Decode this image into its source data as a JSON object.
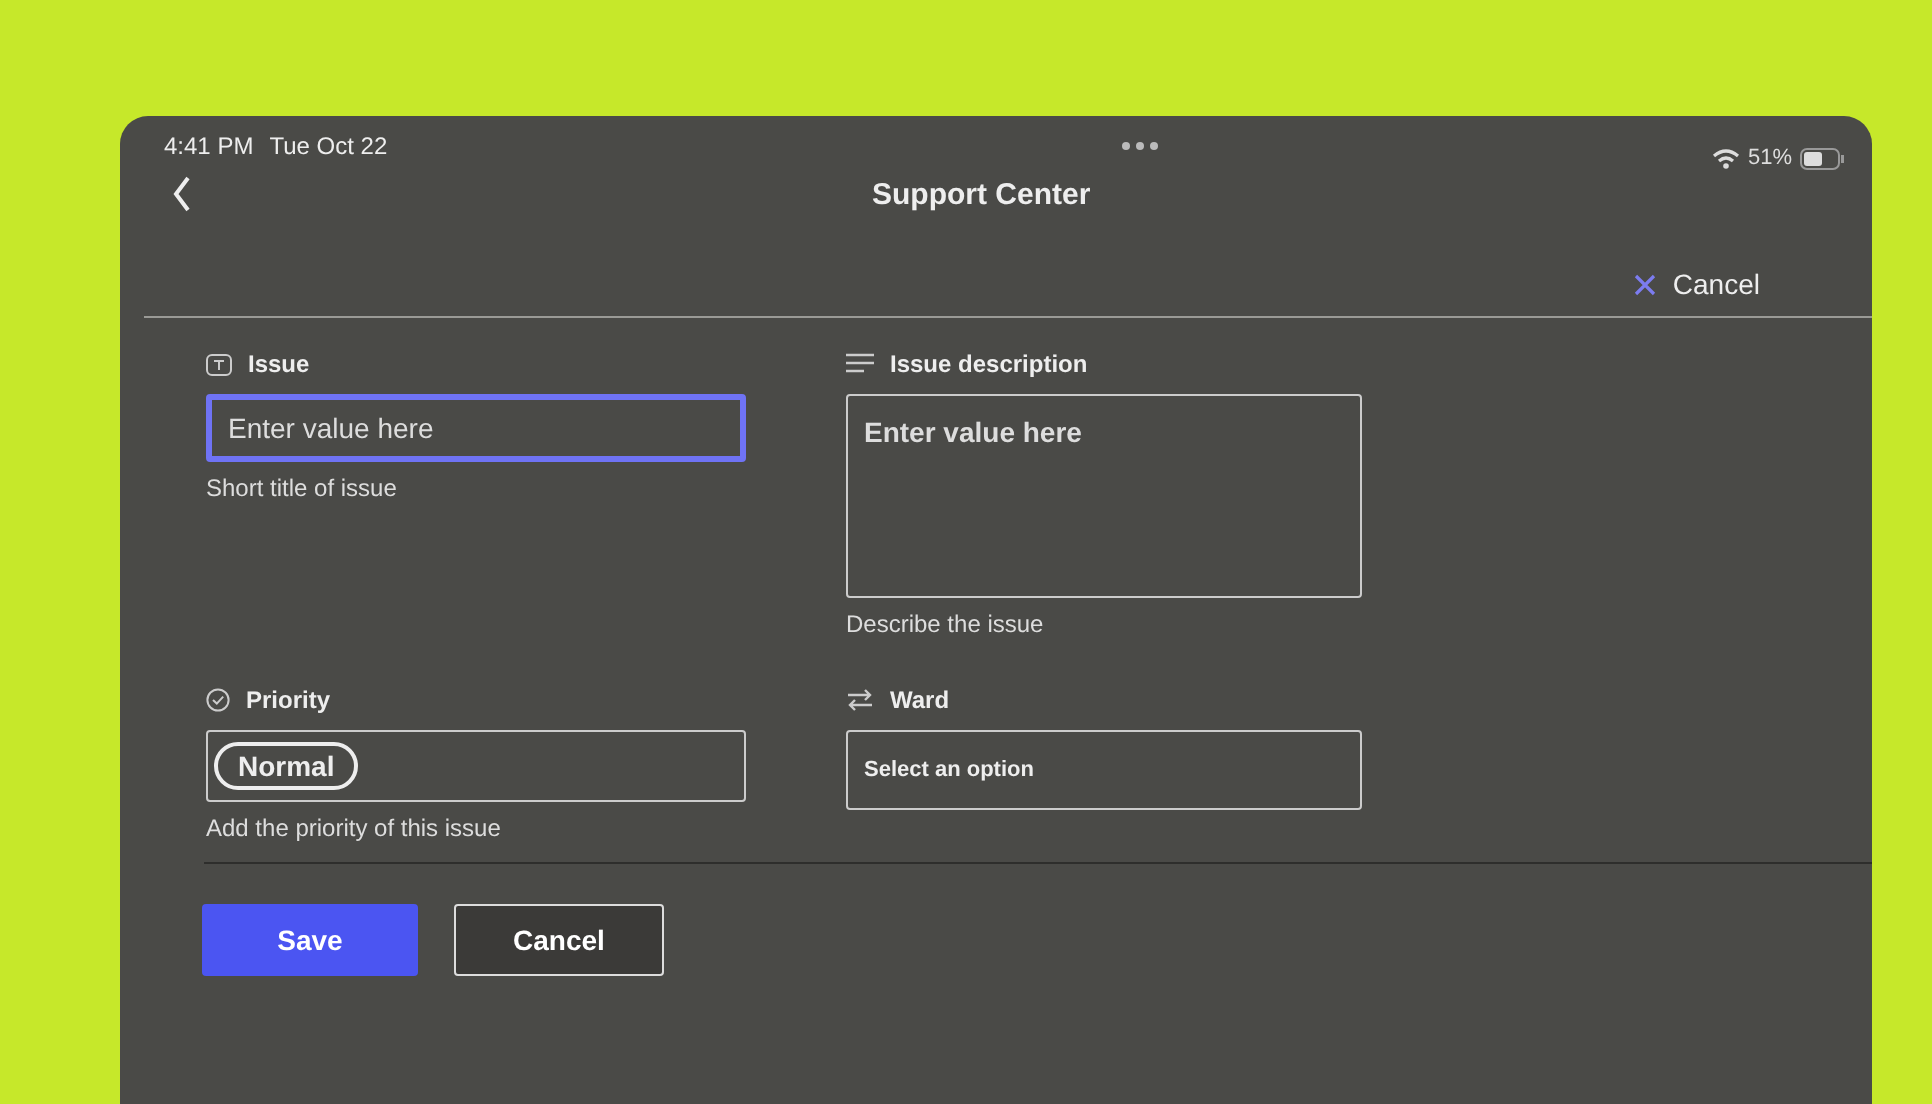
{
  "status_bar": {
    "time": "4:41 PM",
    "date": "Tue Oct 22",
    "battery": "51%"
  },
  "nav": {
    "title": "Support Center",
    "cancel": "Cancel"
  },
  "fields": [
    {
      "kind": "text",
      "label": "Issue",
      "placeholder": "Enter value here",
      "hint": "Short title of issue",
      "focused": true
    },
    {
      "kind": "textarea",
      "label": "Issue description",
      "placeholder": "Enter value here",
      "hint": "Describe the issue",
      "focused": false
    },
    {
      "kind": "tag",
      "label": "Priority",
      "value": "Normal",
      "hint": "Add the priority of this issue",
      "focused": false
    },
    {
      "kind": "select",
      "label": "Ward",
      "placeholder": "Select an option",
      "focused": false
    }
  ],
  "buttons": [
    {
      "kind": "primary",
      "label": "Save"
    },
    {
      "kind": "secondary",
      "label": "Cancel"
    }
  ]
}
